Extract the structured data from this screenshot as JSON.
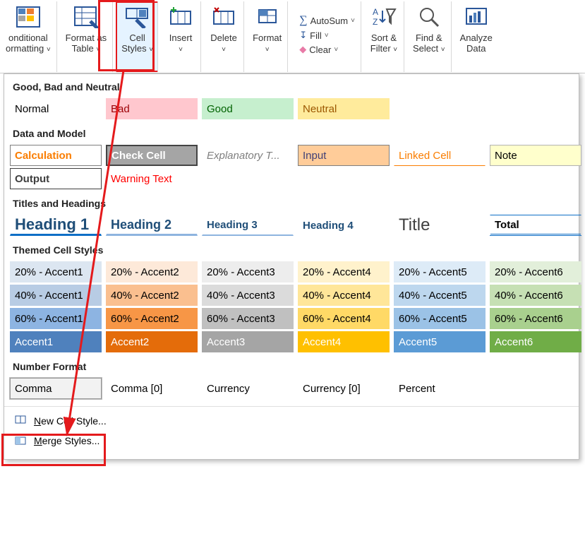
{
  "ribbon": {
    "conditionalFormatting": "onditional\normatting",
    "formatAsTable": "Format as\nTable",
    "cellStyles": "Cell\nStyles",
    "insert": "Insert",
    "delete": "Delete",
    "format": "Format",
    "autosum": "AutoSum",
    "fill": "Fill",
    "clear": "Clear",
    "sortFilter": "Sort &\nFilter",
    "findSelect": "Find &\nSelect",
    "analyze": "Analyze\nData"
  },
  "sections": {
    "goodBad": "Good, Bad and Neutral",
    "dataModel": "Data and Model",
    "titlesHeadings": "Titles and Headings",
    "themed": "Themed Cell Styles",
    "numberFormat": "Number Format"
  },
  "styles": {
    "normal": "Normal",
    "bad": "Bad",
    "good": "Good",
    "neutral": "Neutral",
    "calculation": "Calculation",
    "checkCell": "Check Cell",
    "explanatory": "Explanatory T...",
    "input": "Input",
    "linkedCell": "Linked Cell",
    "note": "Note",
    "output": "Output",
    "warningText": "Warning Text",
    "heading1": "Heading 1",
    "heading2": "Heading 2",
    "heading3": "Heading 3",
    "heading4": "Heading 4",
    "title": "Title",
    "total": "Total"
  },
  "accents": {
    "p20": [
      "20% - Accent1",
      "20% - Accent2",
      "20% - Accent3",
      "20% - Accent4",
      "20% - Accent5",
      "20% - Accent6"
    ],
    "p40": [
      "40% - Accent1",
      "40% - Accent2",
      "40% - Accent3",
      "40% - Accent4",
      "40% - Accent5",
      "40% - Accent6"
    ],
    "p60": [
      "60% - Accent1",
      "60% - Accent2",
      "60% - Accent3",
      "60% - Accent4",
      "60% - Accent5",
      "60% - Accent6"
    ],
    "full": [
      "Accent1",
      "Accent2",
      "Accent3",
      "Accent4",
      "Accent5",
      "Accent6"
    ]
  },
  "numberFormats": {
    "comma": "Comma",
    "comma0": "Comma [0]",
    "currency": "Currency",
    "currency0": "Currency [0]",
    "percent": "Percent"
  },
  "footer": {
    "newCellStyle": "New Cell Style...",
    "mergeStyles": "Merge Styles..."
  }
}
